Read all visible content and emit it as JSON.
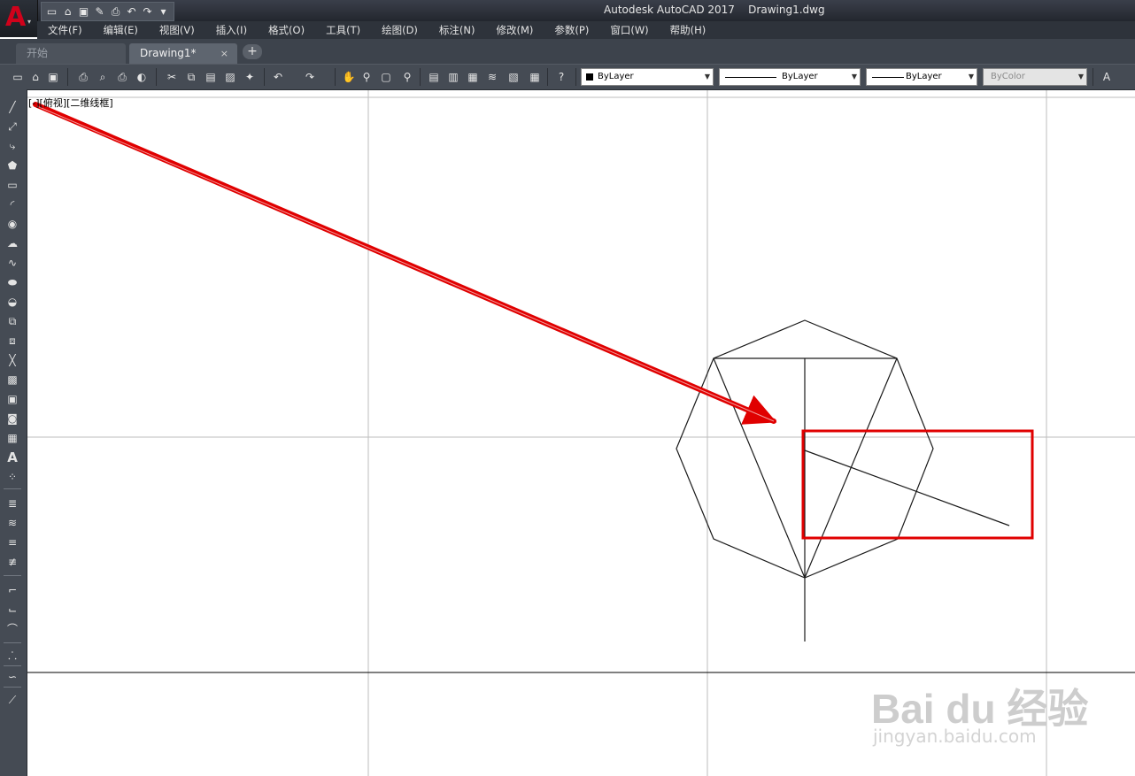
{
  "window": {
    "title": "Autodesk AutoCAD 2017    Drawing1.dwg"
  },
  "app_button": {
    "glyph": "A",
    "caret": "▾"
  },
  "quick_access": [
    "new-icon",
    "open-icon",
    "save-icon",
    "save-as-icon",
    "print-icon",
    "undo-icon",
    "redo-icon",
    "customize-icon"
  ],
  "menu": [
    "文件(F)",
    "编辑(E)",
    "视图(V)",
    "插入(I)",
    "格式(O)",
    "工具(T)",
    "绘图(D)",
    "标注(N)",
    "修改(M)",
    "参数(P)",
    "窗口(W)",
    "帮助(H)"
  ],
  "tabs": {
    "start": "开始",
    "active": "Drawing1*",
    "close_glyph": "×",
    "add_glyph": "+"
  },
  "properties": {
    "color": "ByLayer",
    "linetype": "ByLayer",
    "lineweight": "ByLayer",
    "plotstyle": "ByColor"
  },
  "viewport": {
    "label": "[-][俯视][二维线框]"
  },
  "annotation": {
    "color": "#e00000"
  },
  "watermark": {
    "logo": "Bai du 经验",
    "url": "jingyan.baidu.com"
  },
  "colors": {
    "title_bg": "#2b3038",
    "toolbar_bg": "#454b54",
    "canvas_bg": "#ffffff",
    "highlight": "#e00000"
  }
}
